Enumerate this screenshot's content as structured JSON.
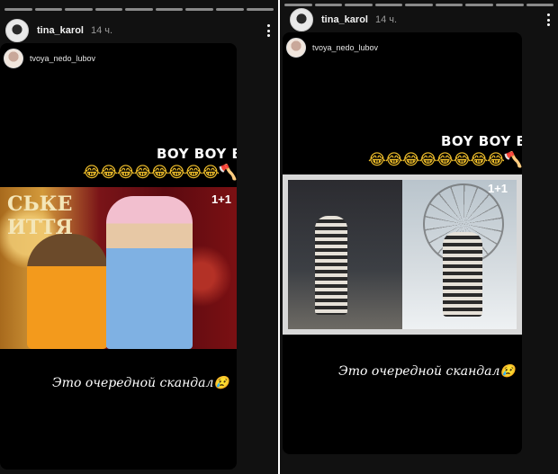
{
  "stories": [
    {
      "username": "tina_karol",
      "time": "14 ч.",
      "repost_user": "tvoya_nedo_lubov",
      "sticker_text": "BOY BOY BOY",
      "emojis": "😂😂😂😂😂😂😂😂🪓",
      "media_sign": "СЬКЕ\nИТТЯ",
      "media_logo": "1+1",
      "caption": "Это очередной скандал😢"
    },
    {
      "username": "tina_karol",
      "time": "14 ч.",
      "repost_user": "tvoya_nedo_lubov",
      "sticker_text": "BOY BOY BOY",
      "emojis": "😂😂😂😂😂😂😂😂🪓",
      "media_logo": "1+1",
      "caption": "Это очередной скандал😢"
    }
  ],
  "icons": {
    "more": "more-vertical-icon"
  }
}
